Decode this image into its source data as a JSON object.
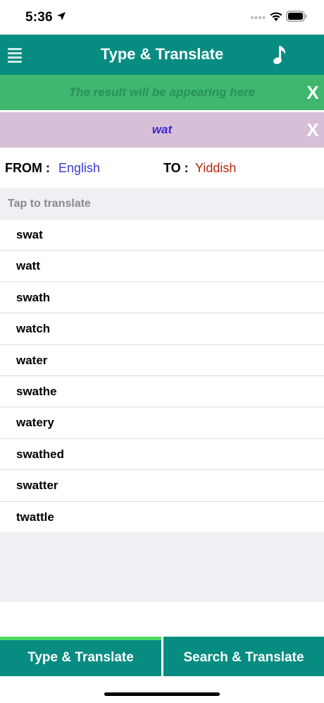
{
  "status_bar": {
    "time": "5:36"
  },
  "header": {
    "title": "Type & Translate"
  },
  "result": {
    "placeholder": "The result will be appearing here",
    "close_label": "X"
  },
  "input": {
    "text": "wat",
    "close_label": "X"
  },
  "languages": {
    "from_label": "FROM :",
    "from_value": "English",
    "to_label": "TO :",
    "to_value": "Yiddish"
  },
  "list": {
    "header": "Tap to translate",
    "items": [
      "swat",
      "watt",
      "swath",
      "watch",
      "water",
      "swathe",
      "watery",
      "swathed",
      "swatter",
      "twattle"
    ]
  },
  "tabs": {
    "type_translate": "Type & Translate",
    "search_translate": "Search & Translate"
  },
  "colors": {
    "header": "#078c82",
    "result_bar": "#3fb76f",
    "input_bar": "#d8bfd8",
    "active_tab_indicator": "#4cd964",
    "from_language": "#3a3ad0",
    "to_language": "#b8280f"
  }
}
